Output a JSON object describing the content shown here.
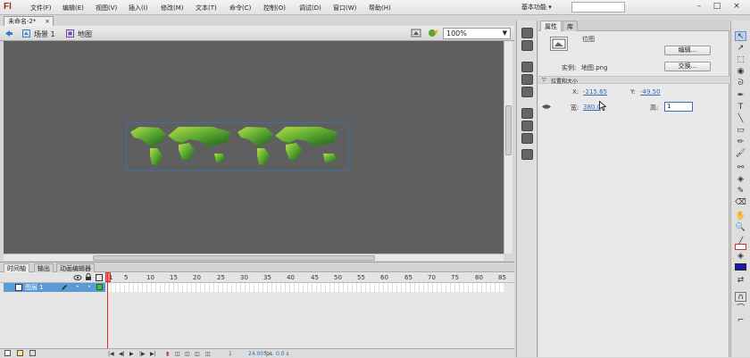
{
  "app": {
    "logo": "Fl"
  },
  "menu": [
    {
      "label": "文件(F)"
    },
    {
      "label": "编辑(E)"
    },
    {
      "label": "视图(V)"
    },
    {
      "label": "插入(I)"
    },
    {
      "label": "修改(M)"
    },
    {
      "label": "文本(T)"
    },
    {
      "label": "命令(C)"
    },
    {
      "label": "控制(O)"
    },
    {
      "label": "调试(D)"
    },
    {
      "label": "窗口(W)"
    },
    {
      "label": "帮助(H)"
    }
  ],
  "workspace": {
    "label": "基本功能"
  },
  "document": {
    "tab_title": "未命名-2*",
    "close": "×"
  },
  "editbar": {
    "scene": "场景 1",
    "symbol": "地图",
    "zoom": "100%"
  },
  "timeline": {
    "tabs": [
      "时间轴",
      "输出",
      "动画编辑器"
    ],
    "layer_name": "图层 1",
    "frame_numbers": [
      "1",
      "5",
      "10",
      "15",
      "20",
      "25",
      "30",
      "35",
      "40",
      "45",
      "50",
      "55",
      "60",
      "65",
      "70",
      "75",
      "80",
      "85"
    ],
    "current_frame": "1",
    "fps": "24.00",
    "fps_unit": "fps",
    "time": "0.0 s"
  },
  "properties": {
    "tabs": [
      "属性",
      "库"
    ],
    "type": "位图",
    "edit_button": "编辑...",
    "instance_label": "实例:",
    "instance_name": "地图.png",
    "swap_button": "交换...",
    "section": "位置和大小",
    "x_label": "X:",
    "x_value": "-215.65",
    "y_label": "Y:",
    "y_value": "-49.50",
    "w_label": "宽:",
    "w_value": "380.0",
    "h_label": "高:",
    "h_value": "1"
  },
  "colors": {
    "stage": "#5f5f5f",
    "selection": "#3e6ea8",
    "layer_selected": "#5b9bd5",
    "playhead": "#e0282c",
    "fill": "#1a1aa6"
  }
}
